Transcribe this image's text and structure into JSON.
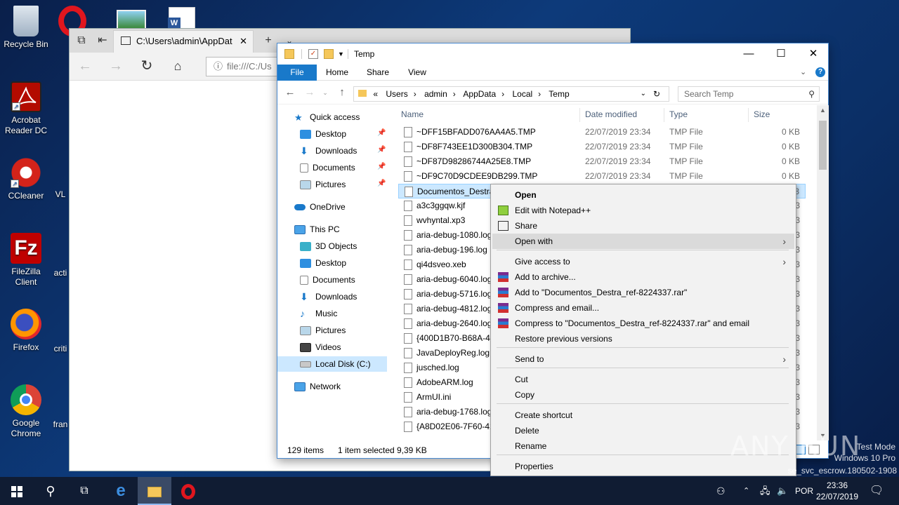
{
  "desktop": {
    "icons": [
      {
        "label": "Recycle Bin",
        "icon": "recycle-bin-icon"
      },
      {
        "label": "Acrobat Reader DC",
        "icon": "acrobat-icon"
      },
      {
        "label": "CCleaner",
        "icon": "ccleaner-icon"
      },
      {
        "label": "FileZilla Client",
        "icon": "filezilla-icon"
      },
      {
        "label": "Firefox",
        "icon": "firefox-icon"
      },
      {
        "label": "Google Chrome",
        "icon": "chrome-icon"
      }
    ],
    "partial_labels": [
      "VL",
      "acti",
      "criti",
      "fran"
    ]
  },
  "edge": {
    "tab_title": "C:\\Users\\admin\\AppDat",
    "address": "file:///C:/Us"
  },
  "explorer": {
    "title": "Temp",
    "ribbon_tabs": [
      "File",
      "Home",
      "Share",
      "View"
    ],
    "breadcrumb": [
      "«",
      "Users",
      "admin",
      "AppData",
      "Local",
      "Temp"
    ],
    "search_placeholder": "Search Temp",
    "nav": {
      "quick_access": "Quick access",
      "quick_items": [
        "Desktop",
        "Downloads",
        "Documents",
        "Pictures"
      ],
      "onedrive": "OneDrive",
      "this_pc": "This PC",
      "pc_items": [
        "3D Objects",
        "Desktop",
        "Documents",
        "Downloads",
        "Music",
        "Pictures",
        "Videos",
        "Local Disk (C:)"
      ],
      "network": "Network"
    },
    "columns": {
      "name": "Name",
      "date": "Date modified",
      "type": "Type",
      "size": "Size"
    },
    "files": [
      {
        "name": "~DFF15BFADD076AA4A5.TMP",
        "date": "22/07/2019 23:34",
        "type": "TMP File",
        "size": "0 KB"
      },
      {
        "name": "~DF8F743EE1D300B304.TMP",
        "date": "22/07/2019 23:34",
        "type": "TMP File",
        "size": "0 KB"
      },
      {
        "name": "~DF87D98286744A25E8.TMP",
        "date": "22/07/2019 23:34",
        "type": "TMP File",
        "size": "0 KB"
      },
      {
        "name": "~DF9C70D9CDEE9DB299.TMP",
        "date": "22/07/2019 23:34",
        "type": "TMP File",
        "size": "0 KB"
      },
      {
        "name": "Documentos_Destra",
        "date": "",
        "type": "",
        "size": "3"
      },
      {
        "name": "a3c3ggqw.kjf",
        "date": "",
        "type": "",
        "size": "3"
      },
      {
        "name": "wvhyntal.xp3",
        "date": "",
        "type": "",
        "size": "3"
      },
      {
        "name": "aria-debug-1080.log",
        "date": "",
        "type": "",
        "size": "3"
      },
      {
        "name": "aria-debug-196.log",
        "date": "",
        "type": "",
        "size": "3"
      },
      {
        "name": "qi4dsveo.xeb",
        "date": "",
        "type": "",
        "size": "3"
      },
      {
        "name": "aria-debug-6040.log",
        "date": "",
        "type": "",
        "size": "3"
      },
      {
        "name": "aria-debug-5716.log",
        "date": "",
        "type": "",
        "size": "3"
      },
      {
        "name": "aria-debug-4812.log",
        "date": "",
        "type": "",
        "size": "3"
      },
      {
        "name": "aria-debug-2640.log",
        "date": "",
        "type": "",
        "size": "3"
      },
      {
        "name": "{400D1B70-B68A-45",
        "date": "",
        "type": "",
        "size": "3"
      },
      {
        "name": "JavaDeployReg.log",
        "date": "",
        "type": "",
        "size": "3"
      },
      {
        "name": "jusched.log",
        "date": "",
        "type": "",
        "size": "3"
      },
      {
        "name": "AdobeARM.log",
        "date": "",
        "type": "",
        "size": "3"
      },
      {
        "name": "ArmUI.ini",
        "date": "",
        "type": "",
        "size": "3"
      },
      {
        "name": "aria-debug-1768.log",
        "date": "",
        "type": "",
        "size": "3"
      },
      {
        "name": "{A8D02E06-7F60-42",
        "date": "",
        "type": "",
        "size": "3"
      }
    ],
    "status": {
      "count": "129 items",
      "selected": "1 item selected",
      "size": "9,39 KB"
    }
  },
  "context_menu": {
    "items": [
      {
        "label": "Open",
        "bold": true
      },
      {
        "label": "Edit with Notepad++"
      },
      {
        "label": "Share"
      },
      {
        "label": "Open with",
        "submenu": true,
        "highlight": true
      },
      {
        "label": "Give access to",
        "submenu": true
      },
      {
        "label": "Add to archive..."
      },
      {
        "label": "Add to \"Documentos_Destra_ref-8224337.rar\""
      },
      {
        "label": "Compress and email..."
      },
      {
        "label": "Compress to \"Documentos_Destra_ref-8224337.rar\" and email"
      },
      {
        "label": "Restore previous versions"
      },
      {
        "label": "Send to",
        "submenu": true
      },
      {
        "label": "Cut"
      },
      {
        "label": "Copy"
      },
      {
        "label": "Create shortcut"
      },
      {
        "label": "Delete"
      },
      {
        "label": "Rename"
      },
      {
        "label": "Properties"
      }
    ]
  },
  "taskbar": {
    "lang": "POR",
    "time": "23:36",
    "date": "22/07/2019"
  },
  "watermark": {
    "line1": "Test Mode",
    "line2": "Windows 10 Pro",
    "line3": "se_svc_escrow.180502-1908",
    "brand": "ANY RUN"
  },
  "colors": {
    "accent": "#1979ca",
    "selection": "#cce8ff",
    "taskbar": "#101c33"
  }
}
